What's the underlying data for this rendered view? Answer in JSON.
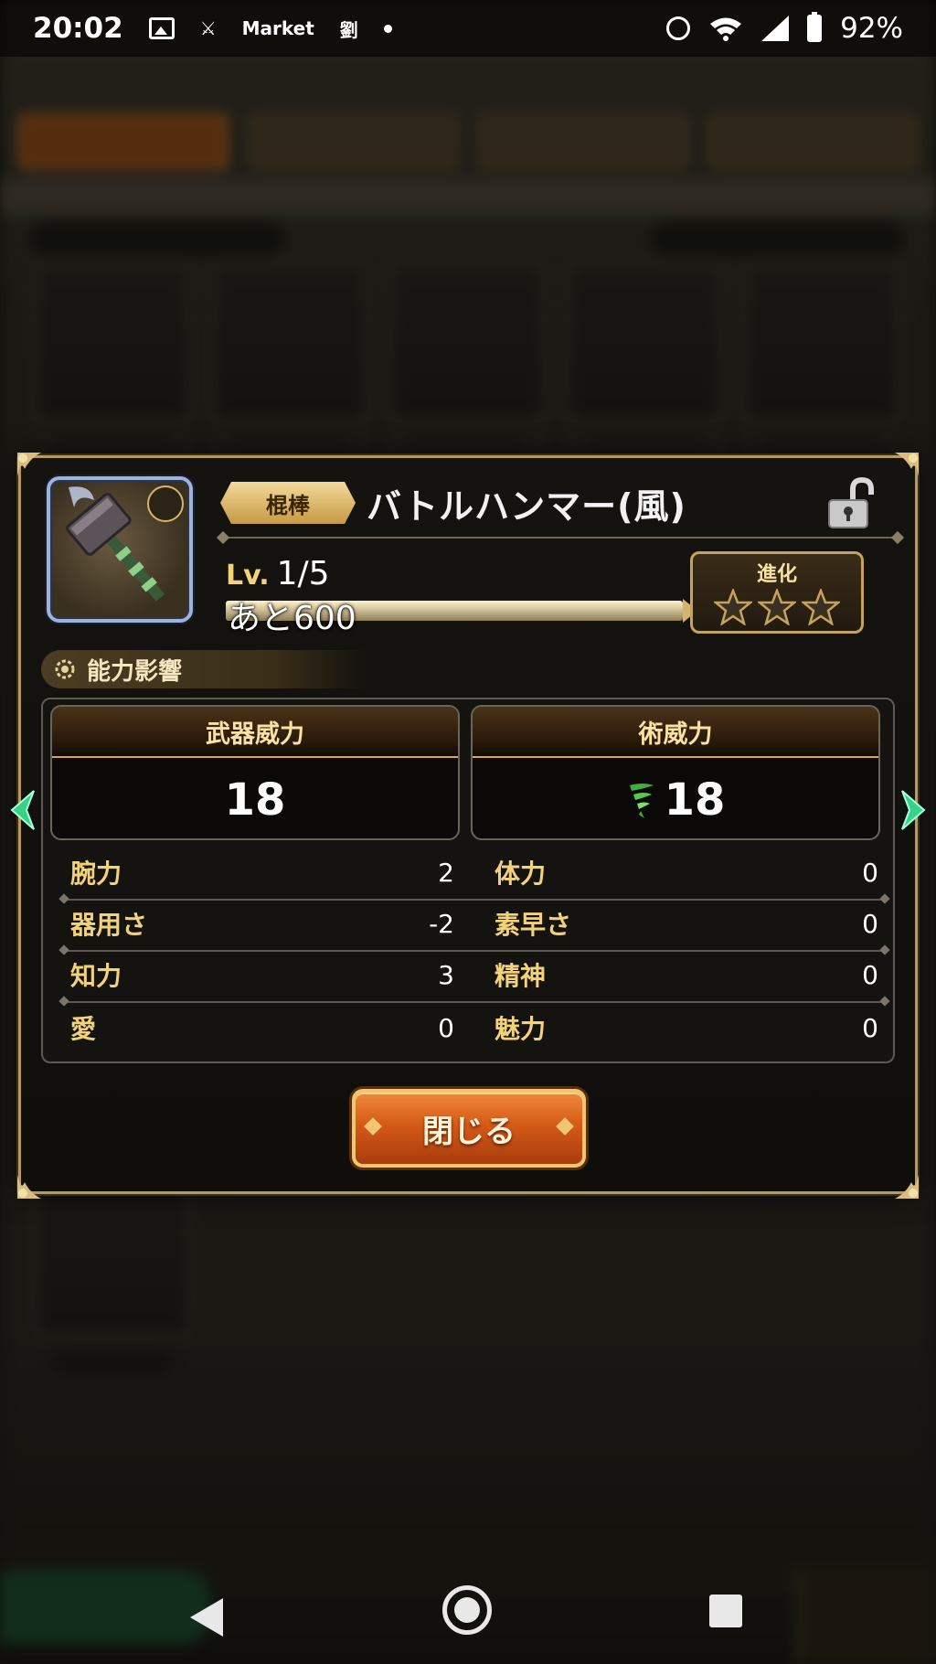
{
  "status_bar": {
    "time": "20:02",
    "notification_texts": [
      "Market",
      "劉"
    ],
    "battery": "92%"
  },
  "modal": {
    "category": "棍棒",
    "weapon_name": "バトルハンマー(風)",
    "level_prefix": "Lv.",
    "level": "1/5",
    "exp_remaining": "あと600",
    "evolution_label": "進化",
    "evolution_stars": 3,
    "section_title": "能力影響",
    "weapon_power_label": "武器威力",
    "weapon_power_value": "18",
    "skill_power_label": "術威力",
    "skill_power_value": "18",
    "stats": [
      {
        "left_label": "腕力",
        "left_value": "2",
        "right_label": "体力",
        "right_value": "0"
      },
      {
        "left_label": "器用さ",
        "left_value": "-2",
        "right_label": "素早さ",
        "right_value": "0"
      },
      {
        "left_label": "知力",
        "left_value": "3",
        "right_label": "精神",
        "right_value": "0"
      },
      {
        "left_label": "愛",
        "left_value": "0",
        "right_label": "魅力",
        "right_value": "0"
      }
    ],
    "close_label": "閉じる"
  },
  "icons": {
    "lock": "unlocked-padlock-icon",
    "element": "wind-element-icon",
    "section": "gear-icon",
    "star": "star-icon"
  },
  "colors": {
    "gold": "#f2d27a",
    "frame": "#b79a5e",
    "button": "#d55a18",
    "wind": "#3fae3a"
  }
}
